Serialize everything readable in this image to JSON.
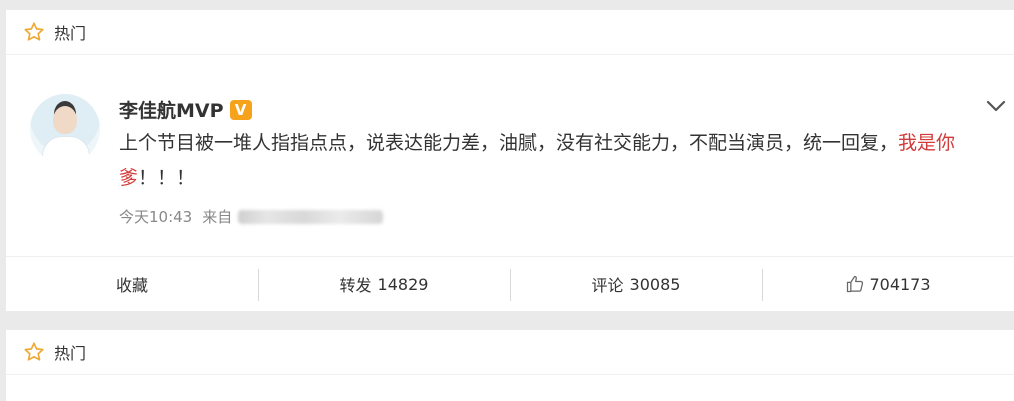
{
  "section_label": "热门",
  "post": {
    "author": "李佳航MVP",
    "badge": "V",
    "text_main": "上个节目被一堆人指指点点，说表达能力差，油腻，没有社交能力，不配当演员，统一回复，",
    "text_highlight": "我是你爹",
    "text_tail": "！！！",
    "time": "今天10:43",
    "source_label": "来自"
  },
  "actions": {
    "favorite_label": "收藏",
    "repost_label": "转发",
    "repost_count": "14829",
    "comment_label": "评论",
    "comment_count": "30085",
    "like_count": "704173"
  },
  "colors": {
    "highlight": "#d33b3b",
    "star": "#f0a733",
    "badge": "#f7a21b"
  },
  "icons": [
    "star-icon",
    "chevron-down-icon",
    "thumbs-up-icon"
  ]
}
